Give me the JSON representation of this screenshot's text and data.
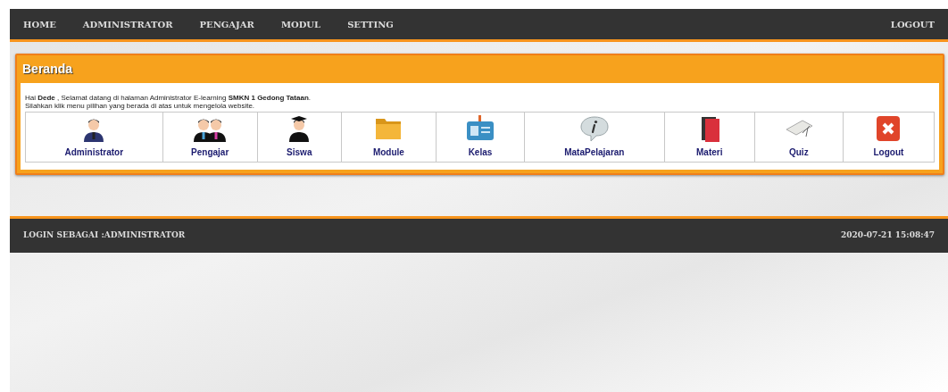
{
  "nav": {
    "items": [
      {
        "label": "HOME"
      },
      {
        "label": "ADMINISTRATOR"
      },
      {
        "label": "PENGAJAR"
      },
      {
        "label": "MODUL"
      },
      {
        "label": "SETTING"
      }
    ],
    "logout": "LOGOUT"
  },
  "panel": {
    "title": "Beranda",
    "lines": [
      "Hai **Dede** , Selamat datang di halaman Administrator E-learning **SMKN 1 Gedong Tataan**.",
      "Silahkan klik menu pilihan yang berada di atas untuk mengelola website."
    ],
    "menu": [
      {
        "kind": "admin",
        "label": "Administrator"
      },
      {
        "kind": "teachers",
        "label": "Pengajar"
      },
      {
        "kind": "student",
        "label": "Siswa"
      },
      {
        "kind": "folder",
        "label": "Module"
      },
      {
        "kind": "idcard",
        "label": "Kelas"
      },
      {
        "kind": "info",
        "label": "MataPelajaran"
      },
      {
        "kind": "books",
        "label": "Materi"
      },
      {
        "kind": "papers",
        "label": "Quiz"
      },
      {
        "kind": "logout",
        "label": "Logout"
      }
    ]
  },
  "footer": {
    "login": "LOGIN SEBAGAI :ADMINISTRATOR",
    "datetime": "2020-07-21 15:08:47"
  }
}
